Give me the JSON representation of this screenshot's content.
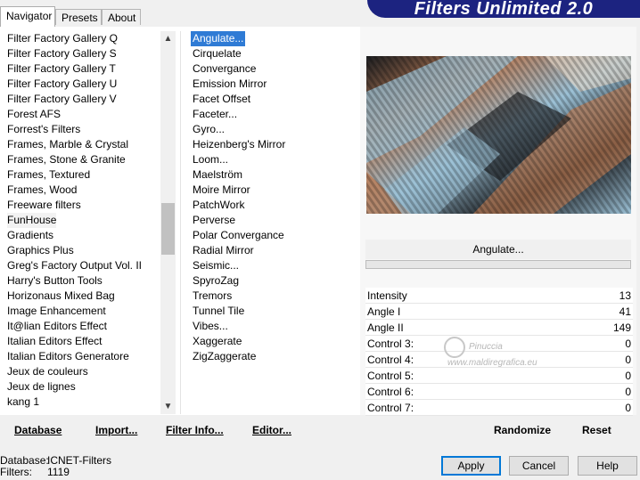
{
  "tabs": [
    "Navigator",
    "Presets",
    "About"
  ],
  "banner_title": "Filters Unlimited 2.0",
  "categories": [
    "Filter Factory Gallery Q",
    "Filter Factory Gallery S",
    "Filter Factory Gallery T",
    "Filter Factory Gallery U",
    "Filter Factory Gallery V",
    "Forest AFS",
    "Forrest's Filters",
    "Frames, Marble & Crystal",
    "Frames, Stone & Granite",
    "Frames, Textured",
    "Frames, Wood",
    "Freeware filters",
    "FunHouse",
    "Gradients",
    "Graphics Plus",
    "Greg's Factory Output Vol. II",
    "Harry's Button Tools",
    "Horizonaus Mixed Bag",
    "Image Enhancement",
    "It@lian Editors Effect",
    "Italian Editors Effect",
    "Italian Editors Generatore",
    "Jeux de couleurs",
    "Jeux de lignes",
    "kang 1"
  ],
  "selected_category": "FunHouse",
  "filters": [
    "Angulate...",
    "Cirquelate",
    "Convergance",
    "Emission Mirror",
    "Facet Offset",
    "Faceter...",
    "Gyro...",
    "Heizenberg's Mirror",
    "Loom...",
    "Maelström",
    "Moire Mirror",
    "PatchWork",
    "Perverse",
    "Polar Convergance",
    "Radial Mirror",
    "Seismic...",
    "SpyroZag",
    "Tremors",
    "Tunnel Tile",
    "Vibes...",
    "Xaggerate",
    "ZigZaggerate"
  ],
  "selected_filter": "Angulate...",
  "preview_filter_name": "Angulate...",
  "controls": [
    {
      "label": "Intensity",
      "value": "13"
    },
    {
      "label": "Angle I",
      "value": "41"
    },
    {
      "label": "Angle II",
      "value": "149"
    },
    {
      "label": "Control 3:",
      "value": "0"
    },
    {
      "label": "Control 4:",
      "value": "0"
    },
    {
      "label": "Control 5:",
      "value": "0"
    },
    {
      "label": "Control 6:",
      "value": "0"
    },
    {
      "label": "Control 7:",
      "value": "0"
    }
  ],
  "watermark": {
    "name": "Pinuccia",
    "url": "www.maldiregrafica.eu"
  },
  "toolbar": {
    "database": "Database",
    "import": "Import...",
    "filter_info": "Filter Info...",
    "editor": "Editor...",
    "randomize": "Randomize",
    "reset": "Reset"
  },
  "status": {
    "database_label": "Database:",
    "database_value": "ICNET-Filters",
    "filters_label": "Filters:",
    "filters_value": "1119"
  },
  "dialog_buttons": {
    "apply": "Apply",
    "cancel": "Cancel",
    "help": "Help"
  },
  "colors": {
    "banner": "#1c2380",
    "selection": "#2f7bd5",
    "preview_blue": "#9cc1d6",
    "preview_copper": "#b97a54",
    "preview_dark": "#1d1f22"
  },
  "icons": {
    "scroll_up": "chevron-up-icon",
    "scroll_down": "chevron-down-icon"
  }
}
